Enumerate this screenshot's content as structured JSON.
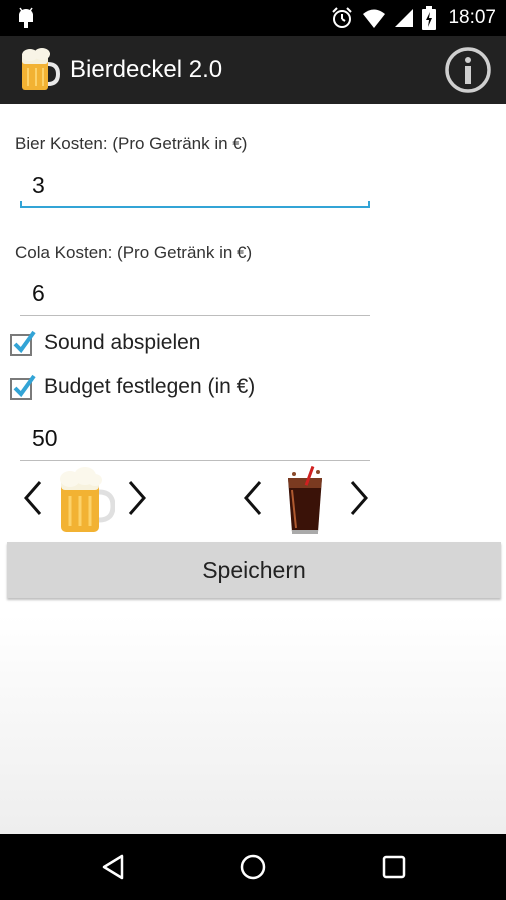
{
  "status_bar": {
    "time": "18:07",
    "icons": [
      "android-debug-icon",
      "alarm-icon",
      "wifi-icon",
      "signal-icon",
      "battery-charging-icon"
    ]
  },
  "action_bar": {
    "title": "Bierdeckel 2.0",
    "logo_icon": "beer-mug-icon",
    "info_icon": "info-icon"
  },
  "form": {
    "beer_cost_label": "Bier Kosten: (Pro Getränk in €)",
    "beer_cost_value": "3",
    "cola_cost_label": "Cola Kosten: (Pro Getränk in €)",
    "cola_cost_value": "6",
    "sound_label": "Sound abspielen",
    "sound_checked": true,
    "budget_label": "Budget festlegen (in €)",
    "budget_checked": true,
    "budget_value": "50"
  },
  "drink_selectors": [
    {
      "name": "beer",
      "icon": "beer-mug-icon"
    },
    {
      "name": "cola",
      "icon": "cola-glass-icon"
    }
  ],
  "save_button": {
    "label": "Speichern"
  },
  "nav_bar": {
    "buttons": [
      "back-icon",
      "home-icon",
      "recents-icon"
    ]
  },
  "colors": {
    "accent": "#33a4d6",
    "check": "#33a4d6",
    "action_bar": "#222222",
    "button": "#d6d6d6"
  }
}
